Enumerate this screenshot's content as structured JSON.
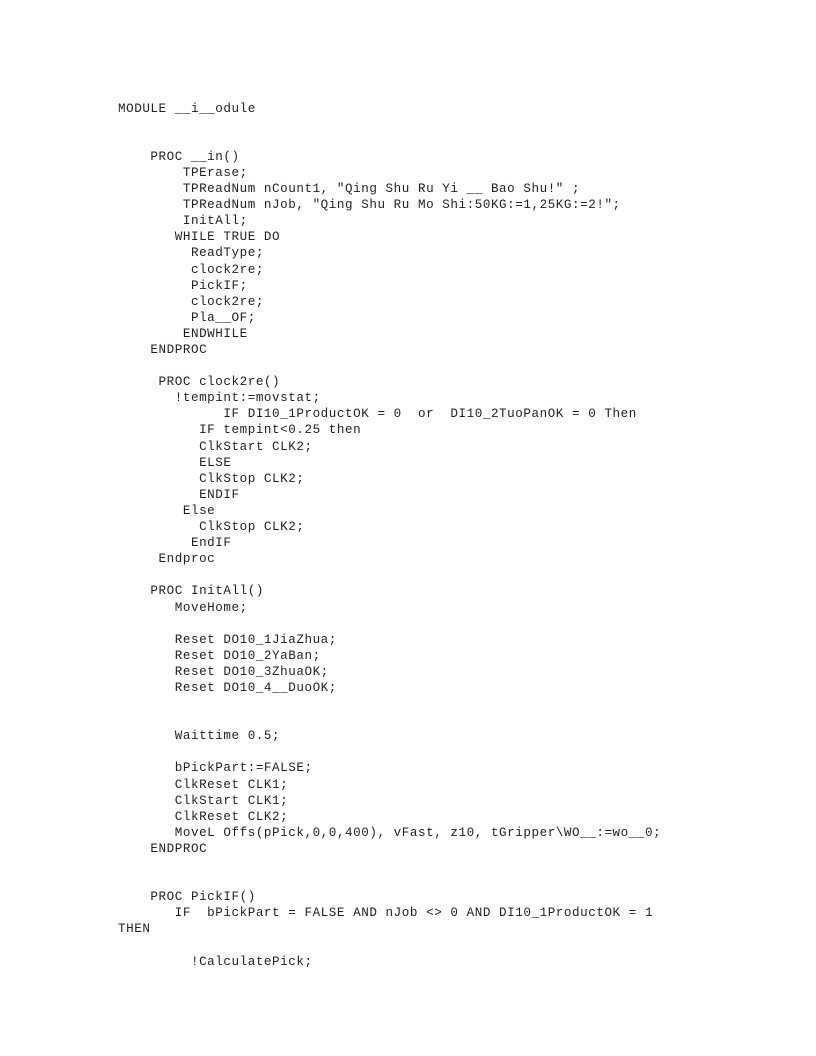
{
  "document": {
    "kind": "source-code-listing",
    "language": "RAPID",
    "module_name": "__i__odule",
    "page_background": "#ffffff",
    "text_color": "#231f20",
    "font_kind": "monospace"
  },
  "code": {
    "lines": [
      "MODULE __i__odule",
      "",
      "",
      "    PROC __in()",
      "        TPErase;",
      "        TPReadNum nCount1, \"Qing Shu Ru Yi __ Bao Shu!\" ;",
      "        TPReadNum nJob, \"Qing Shu Ru Mo Shi:50KG:=1,25KG:=2!\";",
      "        InitAll;",
      "       WHILE TRUE DO",
      "         ReadType;",
      "         clock2re;",
      "         PickIF;",
      "         clock2re;",
      "         Pla__OF;",
      "        ENDWHILE",
      "    ENDPROC",
      "",
      "     PROC clock2re()",
      "       !tempint:=movstat;",
      "             IF DI10_1ProductOK = 0  or  DI10_2TuoPanOK = 0 Then",
      "          IF tempint<0.25 then",
      "          ClkStart CLK2;",
      "          ELSE",
      "          ClkStop CLK2;",
      "          ENDIF",
      "        Else",
      "          ClkStop CLK2;",
      "         EndIF",
      "     Endproc",
      "",
      "    PROC InitAll()",
      "       MoveHome;",
      "",
      "       Reset DO10_1JiaZhua;",
      "       Reset DO10_2YaBan;",
      "       Reset DO10_3ZhuaOK;",
      "       Reset DO10_4__DuoOK;",
      "",
      "",
      "       Waittime 0.5;",
      "",
      "       bPickPart:=FALSE;",
      "       ClkReset CLK1;",
      "       ClkStart CLK1;",
      "       ClkReset CLK2;",
      "       MoveL Offs(pPick,0,0,400), vFast, z10, tGripper\\WO__:=wo__0;",
      "    ENDPROC",
      "",
      "",
      "    PROC PickIF()",
      "       IF  bPickPart = FALSE AND nJob <> 0 AND DI10_1ProductOK = 1",
      "THEN",
      "",
      "         !CalculatePick;"
    ]
  }
}
